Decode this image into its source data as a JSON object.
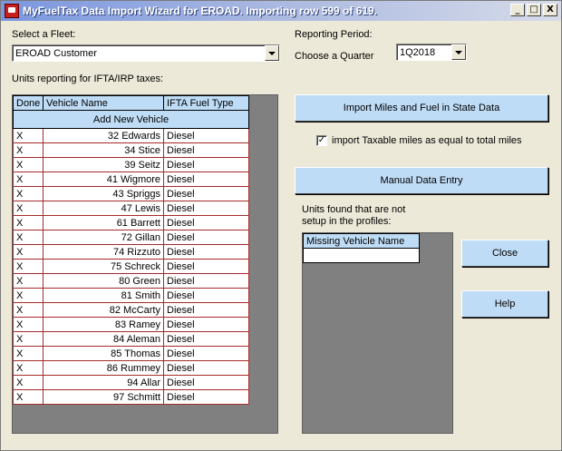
{
  "window": {
    "title": "MyFuelTax Data Import Wizard for EROAD. Importing row 599 of 619.",
    "minimize_label": "_",
    "maximize_label": "□",
    "close_label": "X"
  },
  "fleet": {
    "label": "Select a Fleet:",
    "value": "EROAD Customer"
  },
  "units_label": "Units reporting for IFTA/IRP taxes:",
  "vehicle_table": {
    "headers": [
      "Done",
      "Vehicle Name",
      "IFTA Fuel Type"
    ],
    "add_new_label": "Add New Vehicle",
    "rows": [
      {
        "done": "X",
        "name": "32 Edwards",
        "fuel": "Diesel"
      },
      {
        "done": "X",
        "name": "34 Stice",
        "fuel": "Diesel"
      },
      {
        "done": "X",
        "name": "39 Seitz",
        "fuel": "Diesel"
      },
      {
        "done": "X",
        "name": "41 Wigmore",
        "fuel": "Diesel"
      },
      {
        "done": "X",
        "name": "43 Spriggs",
        "fuel": "Diesel"
      },
      {
        "done": "X",
        "name": "47 Lewis",
        "fuel": "Diesel"
      },
      {
        "done": "X",
        "name": "61 Barrett",
        "fuel": "Diesel"
      },
      {
        "done": "X",
        "name": "72 Gillan",
        "fuel": "Diesel"
      },
      {
        "done": "X",
        "name": "74 Rizzuto",
        "fuel": "Diesel"
      },
      {
        "done": "X",
        "name": "75 Schreck",
        "fuel": "Diesel"
      },
      {
        "done": "X",
        "name": "80 Green",
        "fuel": "Diesel"
      },
      {
        "done": "X",
        "name": "81 Smith",
        "fuel": "Diesel"
      },
      {
        "done": "X",
        "name": "82 McCarty",
        "fuel": "Diesel"
      },
      {
        "done": "X",
        "name": "83 Ramey",
        "fuel": "Diesel"
      },
      {
        "done": "X",
        "name": "84 Aleman",
        "fuel": "Diesel"
      },
      {
        "done": "X",
        "name": "85 Thomas",
        "fuel": "Diesel"
      },
      {
        "done": "X",
        "name": "86 Rummey",
        "fuel": "Diesel"
      },
      {
        "done": "X",
        "name": "94 Allar",
        "fuel": "Diesel"
      },
      {
        "done": "X",
        "name": "97 Schmitt",
        "fuel": "Diesel"
      }
    ]
  },
  "reporting_period": {
    "label": "Reporting Period:",
    "quarter_label": "Choose a Quarter",
    "quarter_value": "1Q2018"
  },
  "import_button_label": "Import Miles and Fuel in State Data",
  "taxable_checkbox": {
    "checked": true,
    "mark": "✓",
    "label": "import Taxable miles as equal to total miles"
  },
  "manual_entry_label": "Manual Data Entry",
  "missing": {
    "label_line1": "Units found that are not",
    "label_line2": "setup in  the profiles:",
    "header": "Missing Vehicle Name"
  },
  "close_button_label": "Close",
  "help_button_label": "Help",
  "colors": {
    "button_blue": "#bfdcf6",
    "title_blue": "#7a96df",
    "row_border": "#a52a2a",
    "panel_gray": "#808080"
  }
}
